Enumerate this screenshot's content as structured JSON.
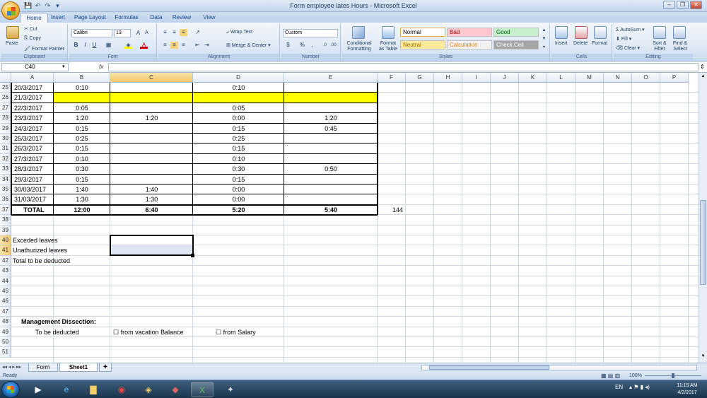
{
  "window": {
    "title": "Form employee lates Hours - Microsoft Excel"
  },
  "qat": {
    "save": "💾",
    "undo": "↶",
    "redo": "↷",
    "customize": "▾"
  },
  "tabs": [
    "Home",
    "Insert",
    "Page Layout",
    "Formulas",
    "Data",
    "Review",
    "View"
  ],
  "ribbon": {
    "clipboard": {
      "label": "Clipboard",
      "paste": "Paste",
      "cut": "Cut",
      "copy": "Copy",
      "format_painter": "Format Painter"
    },
    "font": {
      "label": "Font",
      "name": "Calibri",
      "size": "13",
      "bold": "B",
      "italic": "I",
      "underline": "U"
    },
    "alignment": {
      "label": "Alignment",
      "wrap_text": "Wrap Text",
      "merge_center": "Merge & Center"
    },
    "number": {
      "label": "Number",
      "format": "Custom",
      "currency": "$",
      "percent": "%",
      "comma": ","
    },
    "styles": {
      "label": "Styles",
      "conditional": "Conditional Formatting",
      "format_table": "Format as Table",
      "items": [
        {
          "name": "Normal",
          "bg": "#ffffff",
          "fg": "#000000"
        },
        {
          "name": "Bad",
          "bg": "#ffc7ce",
          "fg": "#9c0006"
        },
        {
          "name": "Good",
          "bg": "#c6efce",
          "fg": "#006100"
        },
        {
          "name": "Neutral",
          "bg": "#ffeb9c",
          "fg": "#9c6500"
        },
        {
          "name": "Calculation",
          "bg": "#f2f2f2",
          "fg": "#fa7d00"
        },
        {
          "name": "Check Cell",
          "bg": "#a5a5a5",
          "fg": "#ffffff"
        }
      ]
    },
    "cells": {
      "label": "Cells",
      "insert": "Insert",
      "delete": "Delete",
      "format": "Format"
    },
    "editing": {
      "label": "Editing",
      "autosum": "AutoSum",
      "fill": "Fill",
      "clear": "Clear",
      "sort_filter": "Sort & Filter",
      "find_select": "Find & Select"
    }
  },
  "formula_bar": {
    "name_box": "C40",
    "fx": "fx",
    "value": ""
  },
  "columns": [
    "A",
    "B",
    "C",
    "D",
    "E",
    "F",
    "G",
    "H",
    "I",
    "J",
    "K",
    "L",
    "M",
    "N",
    "O",
    "P"
  ],
  "selected_column": "C",
  "rows": [
    {
      "n": "25",
      "a": "20/3/2017",
      "b": "0:10",
      "c": "",
      "d": "0:10",
      "e": "",
      "f": ""
    },
    {
      "n": "26",
      "a": "21/3/2017",
      "b": "",
      "c": "",
      "d": "",
      "e": "",
      "f": "",
      "highlight": true
    },
    {
      "n": "27",
      "a": "22/3/2017",
      "b": "0:05",
      "c": "",
      "d": "0:05",
      "e": "",
      "f": ""
    },
    {
      "n": "28",
      "a": "23/3/2017",
      "b": "1:20",
      "c": "1:20",
      "d": "0:00",
      "e": "1:20",
      "f": ""
    },
    {
      "n": "29",
      "a": "24/3/2017",
      "b": "0:15",
      "c": "",
      "d": "0:15",
      "e": "0:45",
      "f": ""
    },
    {
      "n": "30",
      "a": "25/3/2017",
      "b": "0:25",
      "c": "",
      "d": "0:25",
      "e": "",
      "f": ""
    },
    {
      "n": "31",
      "a": "26/3/2017",
      "b": "0:15",
      "c": "",
      "d": "0:15",
      "e": "",
      "f": ""
    },
    {
      "n": "32",
      "a": "27/3/2017",
      "b": "0:10",
      "c": "",
      "d": "0:10",
      "e": "",
      "f": ""
    },
    {
      "n": "33",
      "a": "28/3/2017",
      "b": "0:30",
      "c": "",
      "d": "0:30",
      "e": "0:50",
      "f": ""
    },
    {
      "n": "34",
      "a": "29/3/2017",
      "b": "0:15",
      "c": "",
      "d": "0:15",
      "e": "",
      "f": ""
    },
    {
      "n": "35",
      "a": "30/03/2017",
      "b": "1:40",
      "c": "1:40",
      "d": "0:00",
      "e": "",
      "f": ""
    },
    {
      "n": "36",
      "a": "31/03/2017",
      "b": "1:30",
      "c": "1:30",
      "d": "0:00",
      "e": "",
      "f": ""
    },
    {
      "n": "37",
      "a": "TOTAL",
      "b": "12:00",
      "c": "6:40",
      "d": "5:20",
      "e": "5:40",
      "f": "144",
      "bold": true
    }
  ],
  "empty_rows": [
    "38",
    "39"
  ],
  "labels": [
    {
      "n": "40",
      "text": "Exceded leaves"
    },
    {
      "n": "41",
      "text": "Unathurized leaves"
    },
    {
      "n": "42",
      "text": "Total to be deducted"
    }
  ],
  "more_rows": [
    "43",
    "44",
    "45",
    "46",
    "47"
  ],
  "management": {
    "n": "48",
    "title": "Management Dissection:"
  },
  "deduct": {
    "n": "49",
    "label": "To be deducted",
    "opt1": "☐ from vacation Balance",
    "opt2": "☐ from Salary"
  },
  "tail_rows": [
    "50",
    "51"
  ],
  "sheets": [
    "Form",
    "Sheet1"
  ],
  "active_sheet": "Sheet1",
  "status": {
    "ready": "Ready",
    "zoom": "100%"
  },
  "clock": {
    "time": "11:15 AM",
    "date": "4/2/2017",
    "lang": "EN"
  }
}
